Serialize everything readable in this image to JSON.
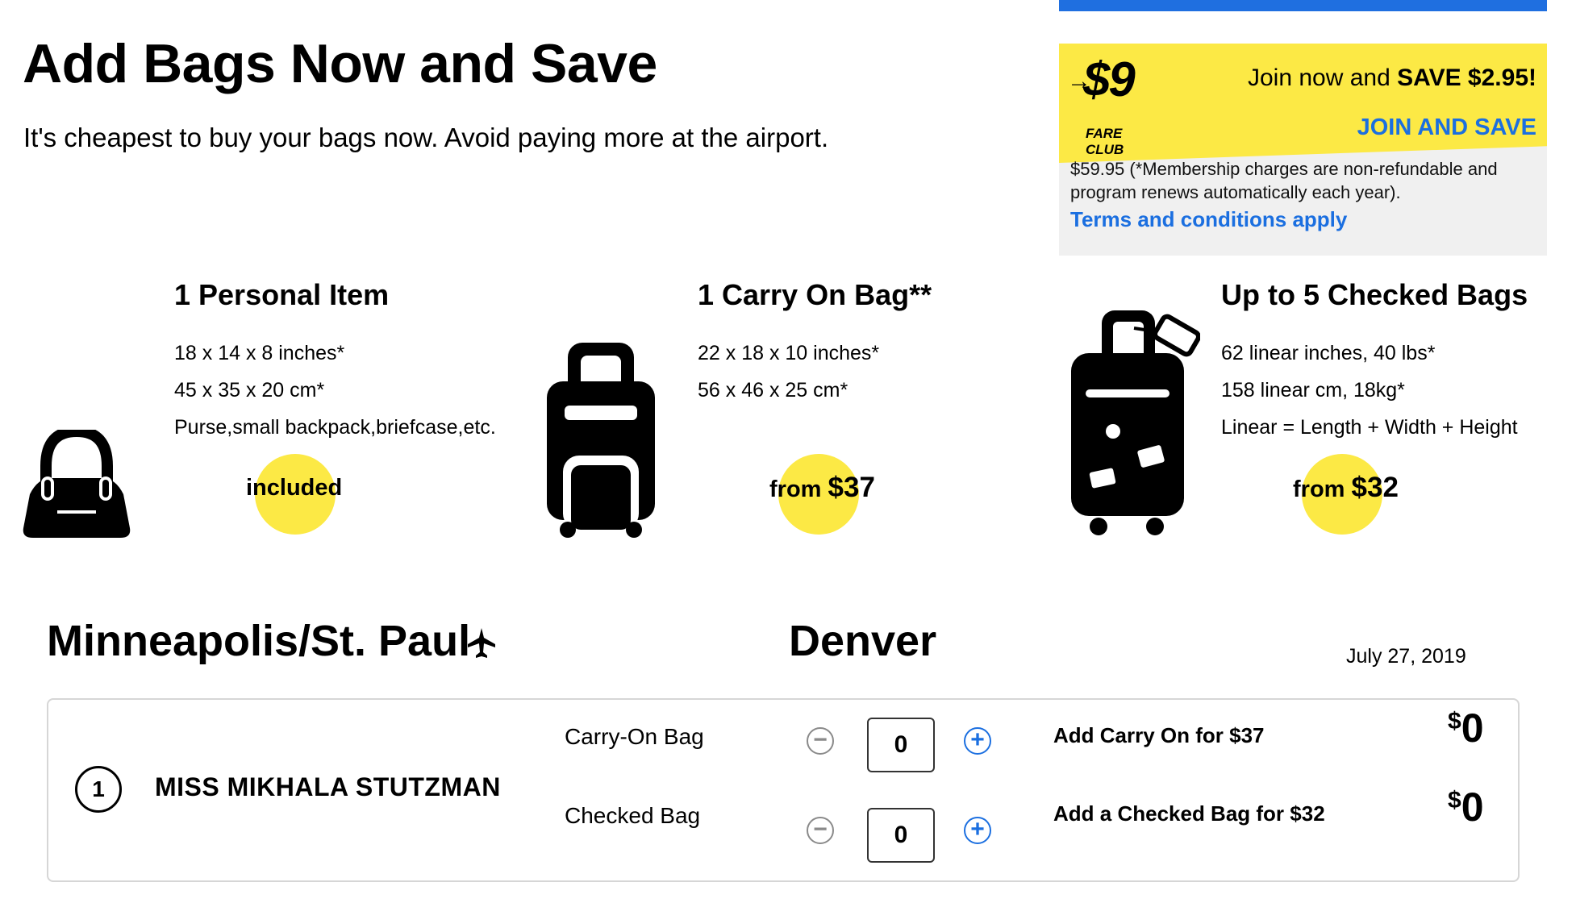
{
  "header": {
    "title": "Add Bags Now and Save",
    "subtitle": "It's cheapest to buy your bags now. Avoid paying more at the airport."
  },
  "promo": {
    "logo_arrow": "→",
    "logo_price": "$9",
    "logo_sub": "FARE CLUB",
    "join_text": "Join now and",
    "join_save": "SAVE $2.95!",
    "cta": "JOIN AND SAVE",
    "fine_print": "$59.95 (*Membership charges are non-refundable and program renews automatically each year).",
    "terms": "Terms and conditions apply",
    "colors": {
      "yellow": "#fce945",
      "link": "#1b6fe0",
      "gray": "#f0f0f0"
    }
  },
  "bags": {
    "personal": {
      "title": "1 Personal Item",
      "lines": [
        "18 x 14 x 8 inches*",
        "45 x 35 x 20 cm*",
        "Purse,small backpack,briefcase,etc."
      ],
      "price_label": "included",
      "icon": "handbag-icon"
    },
    "carry_on": {
      "title": "1 Carry On Bag**",
      "lines": [
        "22 x 18 x 10 inches*",
        "56 x 46 x 25 cm*"
      ],
      "price_prefix": "from",
      "price": "$37",
      "icon": "carry-on-suitcase-icon"
    },
    "checked": {
      "title": "Up to 5 Checked Bags",
      "lines": [
        "62 linear inches, 40 lbs*",
        "158 linear cm, 18kg*",
        "Linear = Length + Width + Height"
      ],
      "price_prefix": "from",
      "price": "$32",
      "icon": "checked-suitcase-icon"
    }
  },
  "route": {
    "origin": "Minneapolis/St. Paul",
    "destination": "Denver",
    "date": "July 27, 2019"
  },
  "passenger": {
    "number": "1",
    "name": "MISS MIKHALA  STUTZMAN",
    "carry_on": {
      "label": "Carry-On Bag",
      "quantity": "0",
      "add_text": "Add Carry On for $37",
      "currency": "$",
      "total": "0"
    },
    "checked": {
      "label": "Checked Bag",
      "quantity": "0",
      "add_text": "Add a Checked Bag for $32",
      "currency": "$",
      "total": "0"
    }
  }
}
